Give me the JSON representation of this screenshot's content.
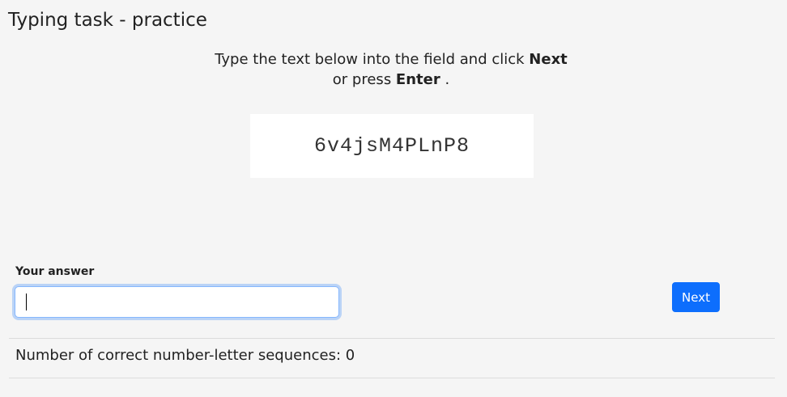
{
  "page": {
    "title": "Typing task - practice"
  },
  "instructions": {
    "part1": "Type the text below into the field and click ",
    "next_word": "Next",
    "part2": "or press ",
    "enter_word": "Enter",
    "part3": " ."
  },
  "task": {
    "code": "6v4jsM4PLnP8"
  },
  "answer": {
    "label": "Your answer",
    "value": "",
    "placeholder": ""
  },
  "buttons": {
    "next_label": "Next"
  },
  "score": {
    "label": "Number of correct number-letter sequences: ",
    "value": "0"
  },
  "colors": {
    "background": "#f5f5f5",
    "primary": "#0d6efd",
    "focus_border": "#86b7fe"
  }
}
